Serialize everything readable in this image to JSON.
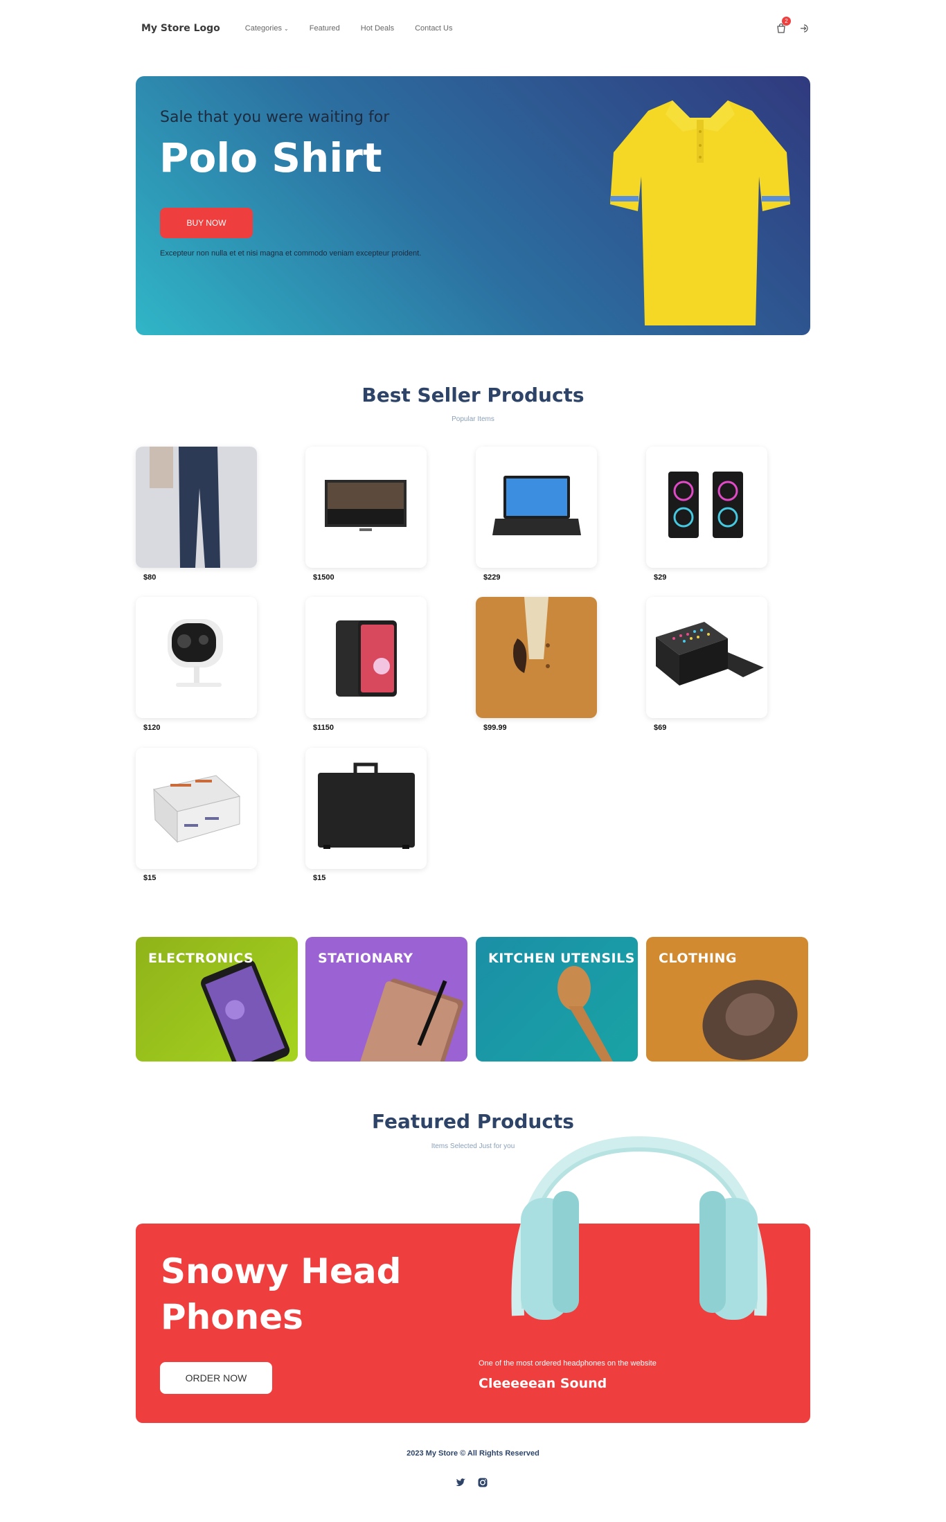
{
  "nav": {
    "logo": "My Store Logo",
    "menu": [
      "Categories",
      "Featured",
      "Hot Deals",
      "Contact Us"
    ],
    "cart_count": "2"
  },
  "hero": {
    "subtitle": "Sale that you were waiting for",
    "title": "Polo Shirt",
    "button": "BUY NOW",
    "description": "Excepteur non nulla et et nisi magna et commodo veniam excepteur proident."
  },
  "best_seller": {
    "title": "Best Seller Products",
    "subtitle": "Popular Items",
    "products": [
      {
        "price": "$80"
      },
      {
        "price": "$1500"
      },
      {
        "price": "$229"
      },
      {
        "price": "$29"
      },
      {
        "price": "$120"
      },
      {
        "price": "$1150"
      },
      {
        "price": "$99.99"
      },
      {
        "price": "$69"
      },
      {
        "price": "$15"
      },
      {
        "price": "$15"
      }
    ]
  },
  "categories": [
    "ELECTRONICS",
    "STATIONARY",
    "KITCHEN UTENSILS",
    "CLOTHING"
  ],
  "featured": {
    "title": "Featured Products",
    "subtitle": "Items Selected Just for you",
    "product_name": "Snowy Head Phones",
    "button": "ORDER NOW",
    "note": "One of the most ordered headphones on the website",
    "tagline": "Cleeeeean Sound"
  },
  "footer": {
    "copyright": "2023 My Store © All Rights Reserved"
  }
}
